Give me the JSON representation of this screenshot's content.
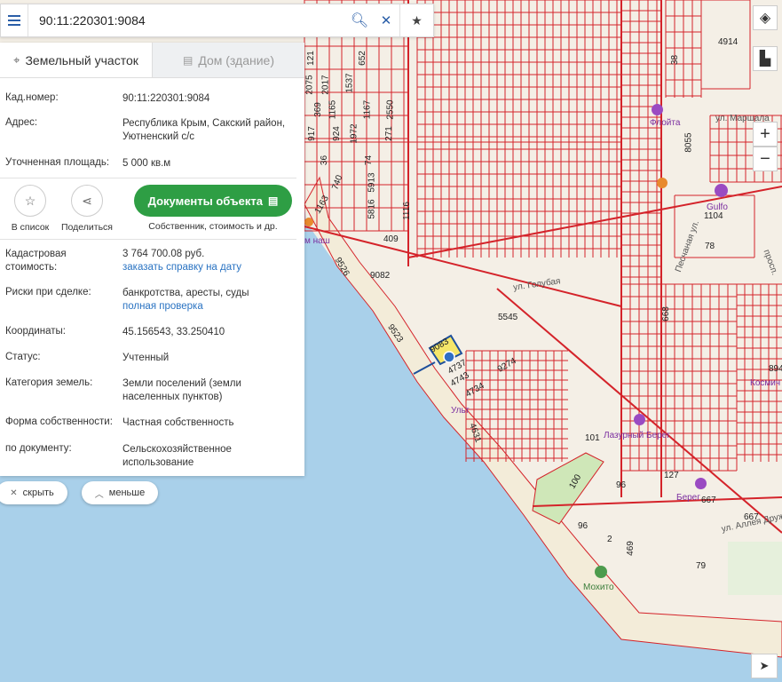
{
  "search": {
    "value": "90:11:220301:9084"
  },
  "tabs": [
    {
      "label": "Земельный участок",
      "icon": "map-pin-icon"
    },
    {
      "label": "Дом (здание)",
      "icon": "building-icon"
    }
  ],
  "parcel": {
    "cadastral_label": "Кад.номер:",
    "cadastral_value": "90:11:220301:9084",
    "address_label": "Адрес:",
    "address_value": "Республика Крым, Сакский район, Уютненский с/с",
    "area_label": "Уточненная площадь:",
    "area_value": "5 000 кв.м",
    "cost_label": "Кадастровая стоимость:",
    "cost_value": "3 764 700.08 руб.",
    "cost_link": "заказать справку на дату",
    "risks_label": "Риски при сделке:",
    "risks_value": "банкротства, аресты, суды",
    "risks_link": "полная проверка",
    "coords_label": "Координаты:",
    "coords_value": "45.156543, 33.250410",
    "status_label": "Статус:",
    "status_value": "Учтенный",
    "category_label": "Категория земель:",
    "category_value": "Земли поселений (земли населенных пунктов)",
    "ownership_label": "Форма собственности:",
    "ownership_value": "Частная собственность",
    "usage_label": "по документу:",
    "usage_value": "Сельскохозяйственное использование"
  },
  "actions": {
    "favorite_label": "В список",
    "share_label": "Поделиться",
    "docs_label": "Документы объекта",
    "docs_sub": "Собственник, стоимость и др."
  },
  "pills": {
    "hide_label": "скрыть",
    "less_label": "меньше"
  },
  "map": {
    "parcels": [
      "4914",
      "38",
      "121",
      "2075",
      "2017",
      "1537",
      "652",
      "369",
      "1165",
      "1167",
      "2550",
      "917",
      "924",
      "1972",
      "271",
      "36",
      "74",
      "740",
      "5913",
      "5816",
      "1116",
      "1163",
      "409",
      "9526",
      "9082",
      "9523",
      "9083",
      "4737",
      "4743",
      "4734",
      "9274",
      "5545",
      "4631",
      "101",
      "100",
      "96",
      "96",
      "2",
      "469",
      "127",
      "667",
      "667",
      "79",
      "668",
      "1104",
      "78",
      "8055",
      "894"
    ],
    "streets": [
      "ул. Маршала",
      "ул. Голубая",
      "Песчаная ул.",
      "ул. Аллея Дружбы",
      "просп."
    ],
    "pois": [
      "Флойта",
      "Gulfo",
      "Лазурный Берег",
      "Берег",
      "Мохито",
      "Ульт",
      "м наш",
      "Космич"
    ]
  },
  "colors": {
    "parcel_line": "#d4232a",
    "sea": "#a9d0ea",
    "land": "#f6f1e7",
    "green": "#cfe7b8",
    "accent": "#2a73c2",
    "button_green": "#2e9e44"
  }
}
